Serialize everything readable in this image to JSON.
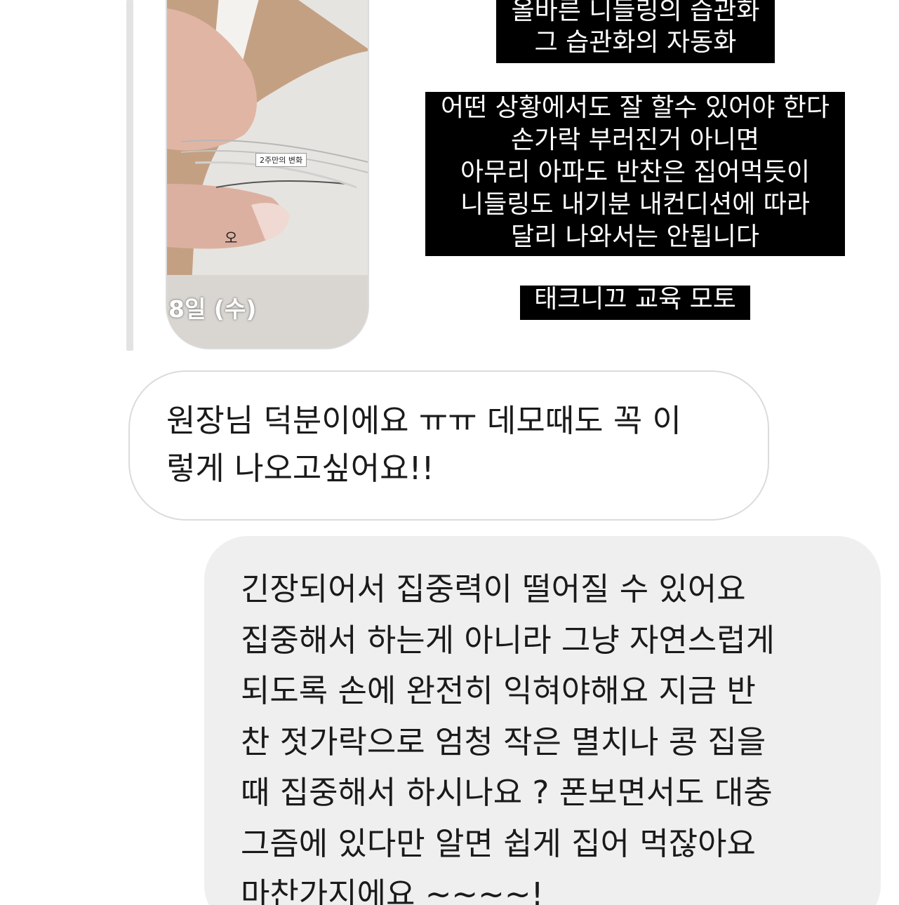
{
  "story": {
    "photo_caption": "2주만의 변화",
    "photo_mark": "오",
    "photo_date": "8일 (수)",
    "text_blocks": [
      {
        "lines": [
          "올바른 니들링의 습관화",
          "그 습관화의 자동화"
        ]
      },
      {
        "lines": [
          "어떤 상황에서도 잘 할수 있어야 한다",
          "손가락 부러진거 아니면",
          "아무리 아파도 반찬은 집어먹듯이",
          "니들링도 내기분 내컨디션에 따라",
          "달리 나와서는 안됩니다"
        ]
      },
      {
        "lines": [
          "태크니끄 교육 모토"
        ]
      }
    ]
  },
  "messages": {
    "incoming": {
      "lines": [
        "원장님 덕분이에요 ㅠㅠ 데모때도 꼭 이",
        "렇게 나오고싶어요!!"
      ]
    },
    "outgoing": {
      "lines": [
        "긴장되어서 집중력이 떨어질 수 있어요",
        "집중해서 하는게 아니라 그냥 자연스럽게",
        "되도록 손에 완전히 익혀야해요 지금 반",
        "찬 젓가락으로 엄청 작은 멸치나 콩 집을",
        "때 집중해서 하시나요 ? 폰보면서도 대충",
        "그즘에 있다만 알면 쉽게 집어 먹잖아요",
        "마찬가지에요 ~~~~!"
      ]
    }
  },
  "colors": {
    "story_text_bg": "#000000",
    "story_text_fg": "#ffffff",
    "outgoing_bubble_bg": "#efefef",
    "incoming_bubble_border": "#dbdbdb",
    "reply_bar": "#e3e3e3"
  }
}
